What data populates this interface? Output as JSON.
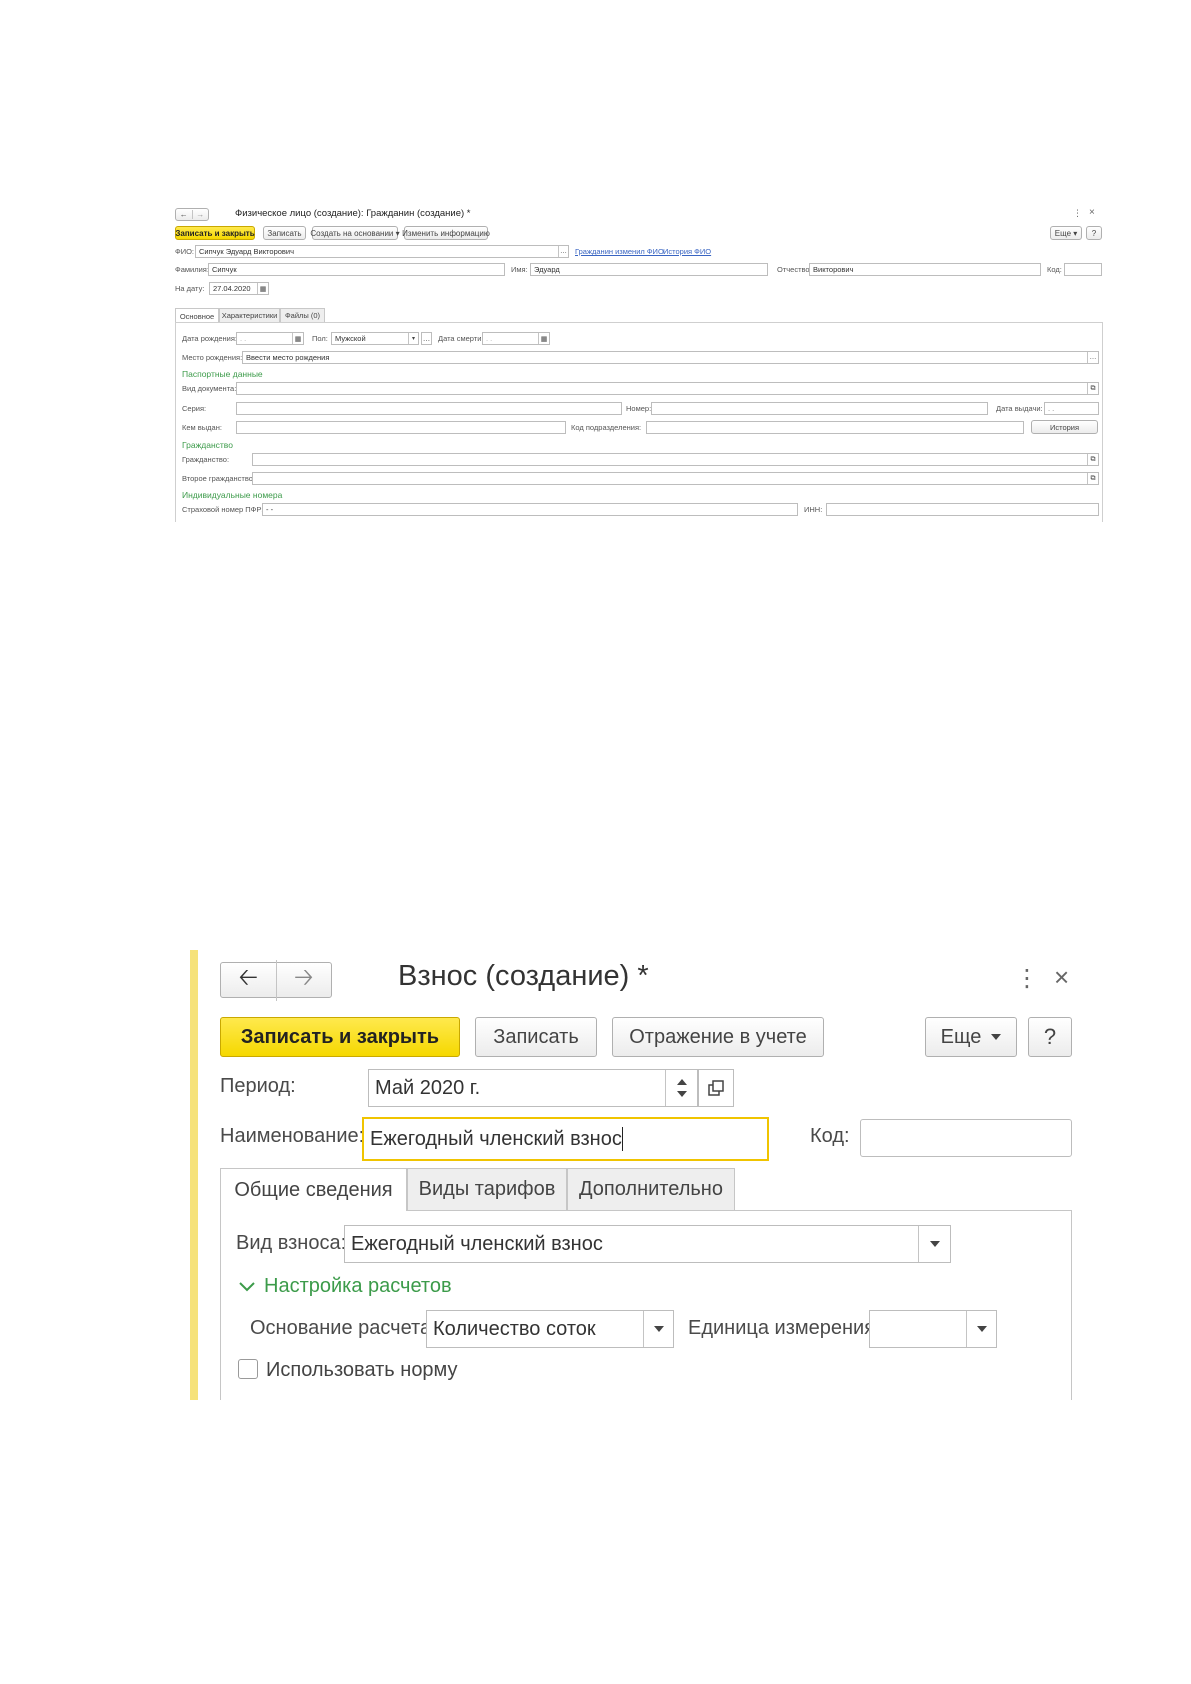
{
  "shot1": {
    "title": "Физическое лицо (создание): Гражданин (создание) *",
    "header_icons": {
      "more": "⋮",
      "close": "×"
    },
    "toolbar": {
      "save_close": "Записать и закрыть",
      "save": "Записать",
      "create_based": "Создать на основании ▾",
      "change_info": "Изменить информацию",
      "more": "Еще ▾",
      "help": "?"
    },
    "fio": {
      "label": "ФИО:",
      "value": "Сипчук Эдуард Викторович",
      "link1": "Гражданин изменил ФИО",
      "link2": "История ФИО"
    },
    "surname": {
      "label": "Фамилия:",
      "value": "Сипчук"
    },
    "name": {
      "label": "Имя:",
      "value": "Эдуард"
    },
    "patronymic": {
      "label": "Отчество:",
      "value": "Викторович"
    },
    "code": {
      "label": "Код:",
      "value": ""
    },
    "on_date": {
      "label": "На дату:",
      "value": "27.04.2020"
    },
    "tabs": [
      "Основное",
      "Характеристики",
      "Файлы (0)"
    ],
    "birth_date": {
      "label": "Дата рождения:",
      "value": " .  .    "
    },
    "gender": {
      "label": "Пол:",
      "value": "Мужской"
    },
    "death_date": {
      "label": "Дата смерти:",
      "value": " .  .    "
    },
    "birth_place": {
      "label": "Место рождения:",
      "value": "Ввести место рождения"
    },
    "passport": {
      "title": "Паспортные данные",
      "doc_type": "Вид документа:",
      "series": "Серия:",
      "number": "Номер:",
      "issue_date": "Дата выдачи:",
      "issue_date_value": " .  .    ",
      "issued_by": "Кем выдан:",
      "division_code": "Код подразделения:",
      "history_btn": "История"
    },
    "citizenship": {
      "title": "Гражданство",
      "label": "Гражданство:",
      "second": "Второе гражданство:"
    },
    "ids": {
      "title": "Индивидуальные номера",
      "snils": "Страховой номер ПФР:",
      "snils_value": "-   -",
      "inn": "ИНН:"
    }
  },
  "shot2": {
    "title": "Взнос (создание) *",
    "toolbar": {
      "save_close": "Записать и закрыть",
      "save": "Записать",
      "posting": "Отражение в учете",
      "more": "Еще",
      "help": "?"
    },
    "period": {
      "label": "Период:",
      "value": "Май 2020 г."
    },
    "name": {
      "label": "Наименование:",
      "value": "Ежегодный членский взнос"
    },
    "code": {
      "label": "Код:",
      "value": ""
    },
    "tabs": [
      "Общие сведения",
      "Виды тарифов",
      "Дополнительно"
    ],
    "fee_type": {
      "label": "Вид взноса:",
      "value": "Ежегодный членский взнос"
    },
    "calc_settings": "Настройка расчетов",
    "calc_base": {
      "label": "Основание расчета:",
      "value": "Количество соток"
    },
    "unit": {
      "label": "Единица измерения:",
      "value": ""
    },
    "use_norm": {
      "label": "Использовать норму",
      "checked": false
    }
  }
}
